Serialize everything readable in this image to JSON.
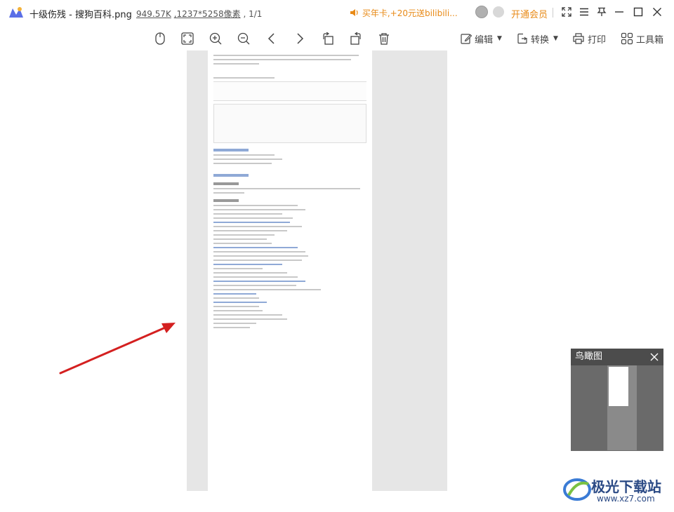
{
  "titlebar": {
    "app_title": "十级伤残 - 搜狗百科.png",
    "file_size": "949.57K",
    "dimensions": "1237*5258像素",
    "page_count": "1/1",
    "promo": "买年卡,+20元送bilibili...",
    "vip_label": "开通会员"
  },
  "toolbar": {
    "edit_label": "编辑",
    "convert_label": "转换",
    "print_label": "打印",
    "tools_label": "工具箱"
  },
  "birdseye": {
    "title": "鸟瞰图"
  },
  "watermark": {
    "name": "极光下载站",
    "url": "www.xz7.com"
  },
  "colors": {
    "accent": "#e88a17",
    "arrow": "#d42020",
    "link": "#2b4a85"
  }
}
